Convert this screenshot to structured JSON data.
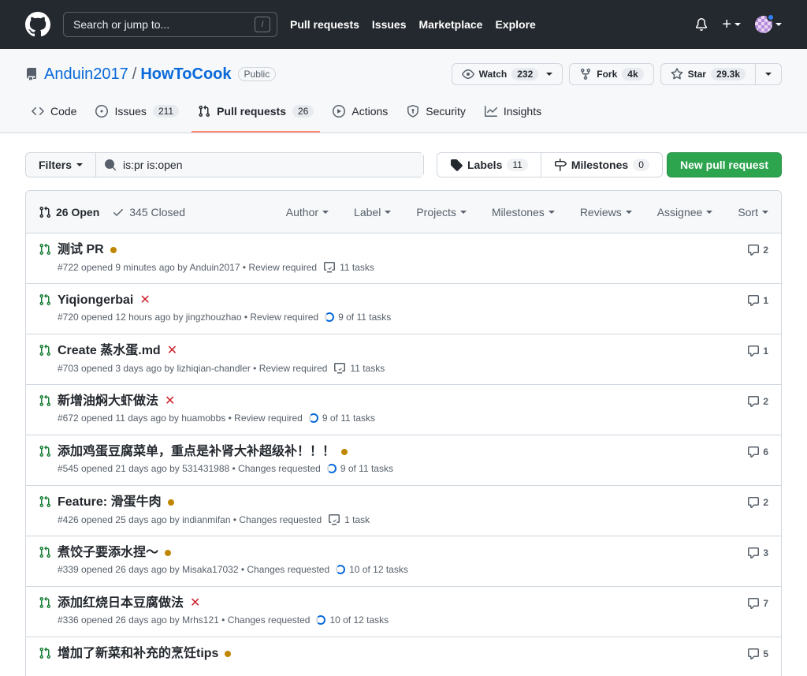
{
  "header": {
    "search_placeholder": "Search or jump to...",
    "search_shortcut": "/",
    "nav": [
      "Pull requests",
      "Issues",
      "Marketplace",
      "Explore"
    ]
  },
  "repo": {
    "owner": "Anduin2017",
    "separator": "/",
    "name": "HowToCook",
    "visibility": "Public",
    "watch_label": "Watch",
    "watch_count": "232",
    "fork_label": "Fork",
    "fork_count": "4k",
    "star_label": "Star",
    "star_count": "29.3k"
  },
  "tabs": [
    {
      "label": "Code",
      "count": null
    },
    {
      "label": "Issues",
      "count": "211"
    },
    {
      "label": "Pull requests",
      "count": "26"
    },
    {
      "label": "Actions",
      "count": null
    },
    {
      "label": "Security",
      "count": null
    },
    {
      "label": "Insights",
      "count": null
    }
  ],
  "filterbar": {
    "filters_label": "Filters",
    "query": "is:pr is:open",
    "labels_label": "Labels",
    "labels_count": "11",
    "milestones_label": "Milestones",
    "milestones_count": "0",
    "new_pr_label": "New pull request"
  },
  "listhead": {
    "open_label": "26 Open",
    "closed_label": "345 Closed",
    "sorts": [
      "Author",
      "Label",
      "Projects",
      "Milestones",
      "Reviews",
      "Assignee",
      "Sort"
    ]
  },
  "prs": [
    {
      "title": "测试 PR",
      "status": "pending",
      "meta": "#722 opened 9 minutes ago by Anduin2017 • Review required",
      "tasks": "11 tasks",
      "task_icon": "checklist",
      "comments": "2"
    },
    {
      "title": "Yiqiongerbai",
      "status": "failed",
      "meta": "#720 opened 12 hours ago by jingzhouzhao • Review required",
      "tasks": "9 of 11 tasks",
      "task_icon": "progress",
      "comments": "1"
    },
    {
      "title": "Create 蒸水蛋.md",
      "status": "failed",
      "meta": "#703 opened 3 days ago by lizhiqian-chandler • Review required",
      "tasks": "11 tasks",
      "task_icon": "checklist",
      "comments": "1"
    },
    {
      "title": "新增油焖大虾做法",
      "status": "failed",
      "meta": "#672 opened 11 days ago by huamobbs • Review required",
      "tasks": "9 of 11 tasks",
      "task_icon": "progress",
      "comments": "2"
    },
    {
      "title": "添加鸡蛋豆腐菜单，重点是补肾大补超级补！！！",
      "status": "pending",
      "meta": "#545 opened 21 days ago by 531431988 • Changes requested",
      "tasks": "9 of 11 tasks",
      "task_icon": "progress",
      "comments": "6"
    },
    {
      "title": "Feature: 滑蛋牛肉",
      "status": "pending",
      "meta": "#426 opened 25 days ago by indianmifan • Changes requested",
      "tasks": "1 task",
      "task_icon": "checklist",
      "comments": "2"
    },
    {
      "title": "煮饺子要添水捏～",
      "status": "pending",
      "meta": "#339 opened 26 days ago by Misaka17032 • Changes requested",
      "tasks": "10 of 12 tasks",
      "task_icon": "progress",
      "comments": "3"
    },
    {
      "title": "添加红烧日本豆腐做法",
      "status": "failed",
      "meta": "#336 opened 26 days ago by Mrhs121 • Changes requested",
      "tasks": "10 of 12 tasks",
      "task_icon": "progress",
      "comments": "7"
    },
    {
      "title": "增加了新菜和补充的烹饪tips",
      "status": "pending",
      "meta": "",
      "tasks": "",
      "task_icon": "",
      "comments": "5"
    }
  ]
}
